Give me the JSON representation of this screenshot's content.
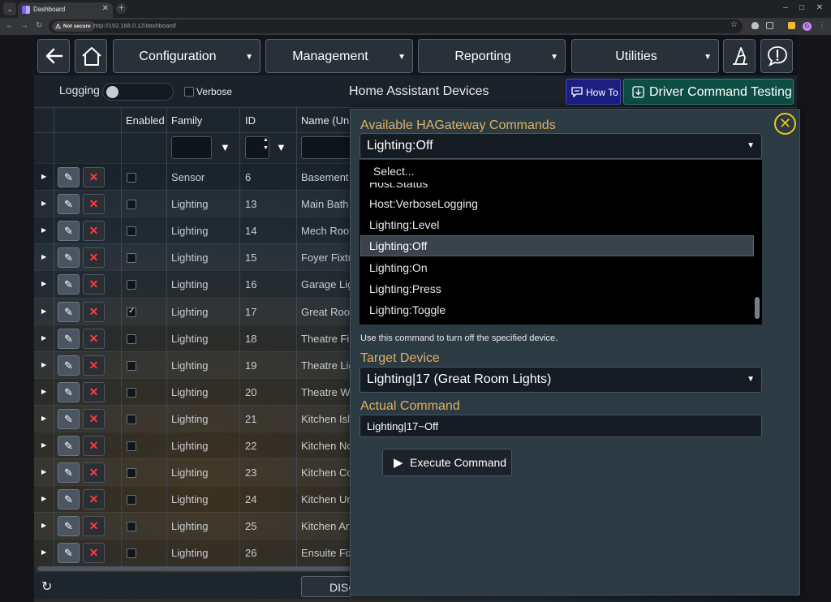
{
  "browser": {
    "tab_title": "Dashboard",
    "not_secure": "Not secure",
    "url": "http://192.168.0.12/dashboard/",
    "profile_initial": "G"
  },
  "nav": {
    "configuration": "Configuration",
    "management": "Management",
    "reporting": "Reporting",
    "utilities": "Utilities"
  },
  "subheader": {
    "logging_label": "Logging",
    "verbose_label": "Verbose",
    "title": "Home Assistant Devices",
    "howto_label": "How To",
    "dct_label": "Driver Command Testing"
  },
  "grid": {
    "columns": {
      "enabled": "Enabled",
      "family": "Family",
      "id": "ID",
      "name": "Name (Unic"
    },
    "rows": [
      {
        "family": "Sensor",
        "id": "6",
        "name": "Basement E",
        "enabled": false
      },
      {
        "family": "Lighting",
        "id": "13",
        "name": "Main Bath I",
        "enabled": false
      },
      {
        "family": "Lighting",
        "id": "14",
        "name": "Mech Room",
        "enabled": false
      },
      {
        "family": "Lighting",
        "id": "15",
        "name": "Foyer Fixtur",
        "enabled": false
      },
      {
        "family": "Lighting",
        "id": "16",
        "name": "Garage Ligh",
        "enabled": false
      },
      {
        "family": "Lighting",
        "id": "17",
        "name": "Great Room",
        "enabled": true
      },
      {
        "family": "Lighting",
        "id": "18",
        "name": "Theatre Fire",
        "enabled": false
      },
      {
        "family": "Lighting",
        "id": "19",
        "name": "Theatre Lig",
        "enabled": false
      },
      {
        "family": "Lighting",
        "id": "20",
        "name": "Theatre Wa",
        "enabled": false
      },
      {
        "family": "Lighting",
        "id": "21",
        "name": "Kitchen Isla",
        "enabled": false
      },
      {
        "family": "Lighting",
        "id": "22",
        "name": "Kitchen Noc",
        "enabled": false
      },
      {
        "family": "Lighting",
        "id": "23",
        "name": "Kitchen Cof",
        "enabled": false
      },
      {
        "family": "Lighting",
        "id": "24",
        "name": "Kitchen Unc",
        "enabled": false
      },
      {
        "family": "Lighting",
        "id": "25",
        "name": "Kitchen Art",
        "enabled": false
      },
      {
        "family": "Lighting",
        "id": "26",
        "name": "Ensuite Fixt",
        "enabled": false
      }
    ],
    "footer_button": "DISC"
  },
  "modal": {
    "commands_label": "Available HAGateway Commands",
    "selected_command": "Lighting:Off",
    "options": [
      "Select...",
      "Host:Status",
      "Host:VerboseLogging",
      "Lighting:Level",
      "Lighting:Off",
      "Lighting:On",
      "Lighting:Press",
      "Lighting:Toggle"
    ],
    "description": "Use this command to turn off the specified device.",
    "target_label": "Target Device",
    "target_value": "Lighting|17 (Great Room Lights)",
    "actual_label": "Actual Command",
    "actual_value": "Lighting|17~Off",
    "execute_label": "Execute Command"
  },
  "colors": {
    "accent_label": "#e0b25f",
    "close_icon": "#f0c419",
    "delete_icon": "#ff3b3b",
    "howto_bg": "#1c1f80",
    "dct_bg": "#0e4d44"
  },
  "icons": [
    "back-arrow-icon",
    "home-icon",
    "wizard-hat-icon",
    "feedback-icon",
    "filter-icon",
    "pencil-icon",
    "delete-x-icon",
    "refresh-icon",
    "close-icon",
    "play-icon",
    "download-icon",
    "chat-icon"
  ]
}
